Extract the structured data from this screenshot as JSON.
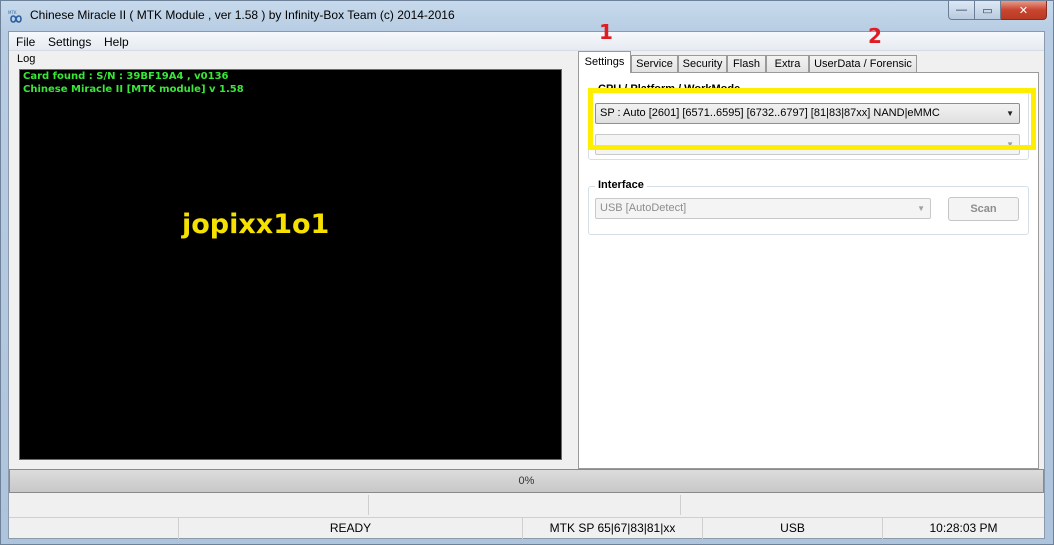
{
  "window": {
    "title": "Chinese Miracle II ( MTK Module , ver 1.58 ) by Infinity-Box Team (c) 2014-2016",
    "minimize_glyph": "—",
    "maximize_glyph": "▭",
    "close_glyph": "✕"
  },
  "menu": {
    "items": [
      "File",
      "Settings",
      "Help"
    ]
  },
  "log": {
    "label": "Log",
    "lines": [
      "Card found : S/N : 39BF19A4 , v0136",
      "Chinese Miracle II  [MTK module] v 1.58"
    ],
    "watermark": "jopixx1o1"
  },
  "tabs": [
    "Settings",
    "Service",
    "Security",
    "Flash",
    "Extra",
    "UserData / Forensic"
  ],
  "active_tab": "Settings",
  "settings": {
    "cpu_group_title": "CPU / Platform / WorkMode",
    "cpu_value": "SP : Auto [2601] [6571..6595] [6732..6797] [81|83|87xx]  NAND|eMMC",
    "second_value": "",
    "interface_group_title": "Interface",
    "interface_value": "USB [AutoDetect]",
    "scan_label": "Scan"
  },
  "annotations": {
    "one": "1",
    "two": "2",
    "highlight_color": "#ffee00",
    "number_color": "#e01b24"
  },
  "progress": {
    "text": "0%",
    "value": 0
  },
  "status": {
    "state": "READY",
    "platform": "MTK SP 65|67|83|81|xx",
    "connection": "USB",
    "time": "10:28:03 PM"
  },
  "icons": {
    "app": "infinity-logo-icon",
    "dropdown": "chevron-down-icon"
  },
  "colors": {
    "log_text": "#38e838",
    "log_background": "#000000",
    "watermark": "#f5e000"
  }
}
